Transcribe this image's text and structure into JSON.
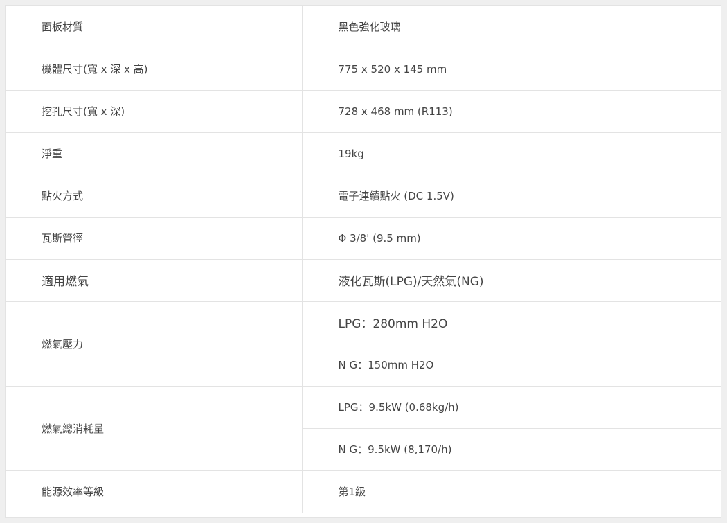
{
  "specs": [
    {
      "label": "面板材質",
      "value": "黑色強化玻璃"
    },
    {
      "label": "機體尺寸(寬 x 深 x 高)",
      "value": "775 x 520 x 145 mm"
    },
    {
      "label": "挖孔尺寸(寬 x 深)",
      "value": "728 x 468 mm (R113)"
    },
    {
      "label": "淨重",
      "value": "19kg"
    },
    {
      "label": "點火方式",
      "value": "電子連續點火 (DC 1.5V)"
    },
    {
      "label": "瓦斯管徑",
      "value": "Φ 3/8' (9.5 mm)"
    },
    {
      "label": "適用燃氣",
      "value": "液化瓦斯(LPG)/天然氣(NG)"
    },
    {
      "label": "燃氣壓力",
      "values": [
        "LPG：280mm H2O",
        "N G：150mm H2O"
      ]
    },
    {
      "label": "燃氣總消耗量",
      "values": [
        "LPG：9.5kW (0.68kg/h)",
        "N G：9.5kW (8,170/h)"
      ]
    },
    {
      "label": "能源效率等級",
      "value": "第1級"
    }
  ]
}
